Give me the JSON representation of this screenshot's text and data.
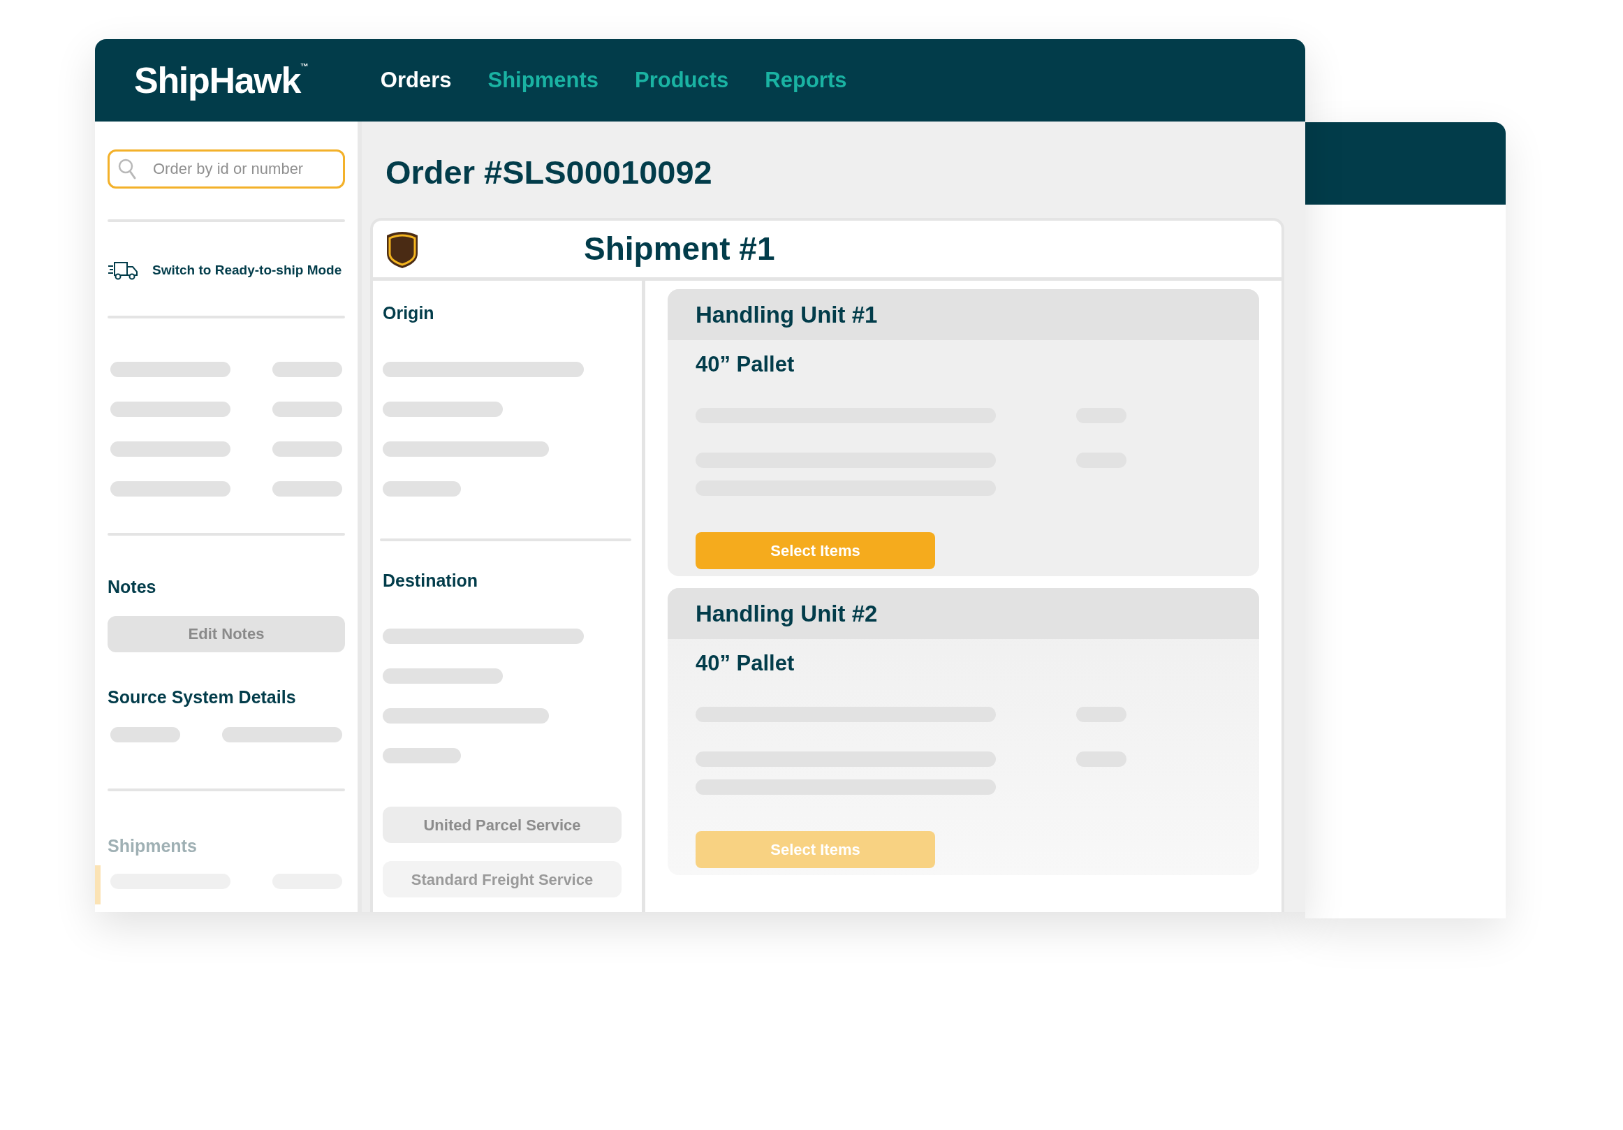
{
  "brand": {
    "name": "ShipHawk",
    "mark": "™"
  },
  "nav": [
    {
      "label": "Orders",
      "selected": true
    },
    {
      "label": "Shipments",
      "selected": false
    },
    {
      "label": "Products",
      "selected": false
    },
    {
      "label": "Reports",
      "selected": false
    }
  ],
  "sidebar": {
    "search": {
      "placeholder": "Order by id or number"
    },
    "mode_link": "Switch to Ready-to-ship Mode",
    "sections": [
      {
        "title": "Notes",
        "muted": false,
        "button": {
          "label": "Edit Notes",
          "disabled": true
        }
      },
      {
        "title": "Source System Details",
        "muted": false
      },
      {
        "title": "Shipments",
        "muted": true
      }
    ]
  },
  "order_title": "Order #SLS00010092",
  "shipment": {
    "title": "Shipment #1",
    "origin_label": "Origin",
    "destination_label": "Destination",
    "carrier_buttons": [
      {
        "label": "United Parcel Service",
        "disabled": true
      },
      {
        "label": "Standard Freight Service",
        "disabled": true
      }
    ],
    "handling_units": [
      {
        "title": "Handling Unit #1",
        "type": "40” Pallet",
        "button": {
          "label": "Select Items",
          "disabled": false
        }
      },
      {
        "title": "Handling Unit #2",
        "type": "40” Pallet",
        "button": {
          "label": "Select Items",
          "disabled": true
        }
      }
    ]
  }
}
